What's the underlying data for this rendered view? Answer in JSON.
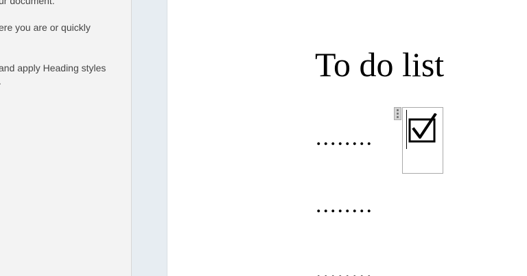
{
  "navigation_pane": {
    "lines": [
      "ur document.",
      "ere you are or quickly",
      "and apply Heading styles",
      "."
    ]
  },
  "document": {
    "title": "To do list",
    "dot_lines": [
      "........",
      "........",
      "........"
    ],
    "checkbox": {
      "state": "checked",
      "icon": "checked-ballot-box-icon"
    }
  }
}
